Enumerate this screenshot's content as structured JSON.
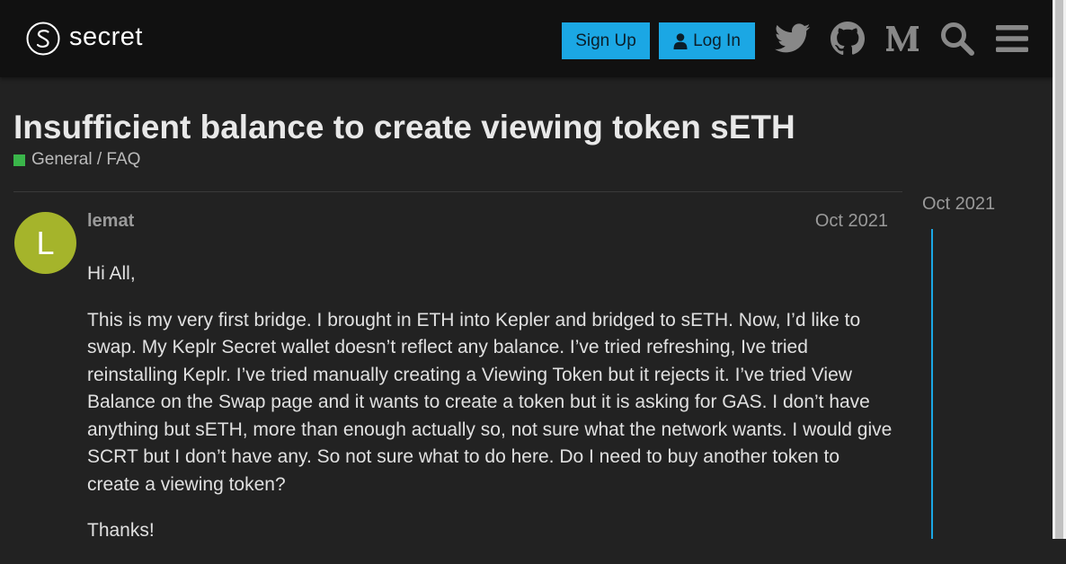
{
  "brand": {
    "name": "secret",
    "logo_icon": "secret-logo-icon"
  },
  "header": {
    "signup_label": "Sign Up",
    "login_label": "Log In",
    "icons": [
      "twitter-icon",
      "github-icon",
      "medium-icon",
      "search-icon",
      "menu-icon"
    ],
    "button_color": "#1ba7e4"
  },
  "topic": {
    "title": "Insufficient balance to create viewing token sETH",
    "category": "General / FAQ",
    "category_color": "#3ab54a"
  },
  "post": {
    "avatar_letter": "L",
    "avatar_color": "#a5b42b",
    "username": "lemat",
    "date": "Oct 2021",
    "paragraphs": [
      "Hi All,",
      "This is my very first bridge. I brought in ETH into Kepler and bridged to sETH. Now, I’d like to swap. My Keplr Secret wallet doesn’t reflect any balance. I’ve tried refreshing, Ive tried reinstalling Keplr. I’ve tried manually creating a Viewing Token but it rejects it. I’ve tried View Balance on the Swap page and it wants to create a token but it is asking for GAS. I don’t have anything but sETH, more than enough actually so, not sure what the network wants. I would give SCRT but I don’t have any. So not sure what to do here. Do I need to buy another token to create a viewing token?",
      "Thanks!"
    ]
  },
  "timeline": {
    "date": "Oct 2021"
  }
}
